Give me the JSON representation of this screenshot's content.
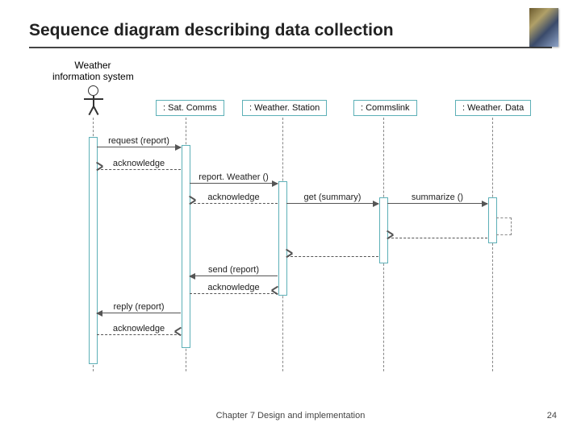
{
  "title": "Sequence diagram describing data collection",
  "footer": "Chapter 7 Design and implementation",
  "page_number": "24",
  "actor": {
    "line1": "Weather",
    "line2": "information system"
  },
  "participants": {
    "satcomms": ": Sat. Comms",
    "weatherstation": ": Weather. Station",
    "commslink": ": Commslink",
    "weatherdata": ": Weather. Data"
  },
  "messages": {
    "request": "request (report)",
    "ack1": "acknowledge",
    "reportweather": "report. Weather ()",
    "ack2": "acknowledge",
    "getsummary": "get (summary)",
    "summarize": "summarize ()",
    "send": "send (report)",
    "ack3": "acknowledge",
    "reply": "reply (report)",
    "ack4": "acknowledge"
  }
}
